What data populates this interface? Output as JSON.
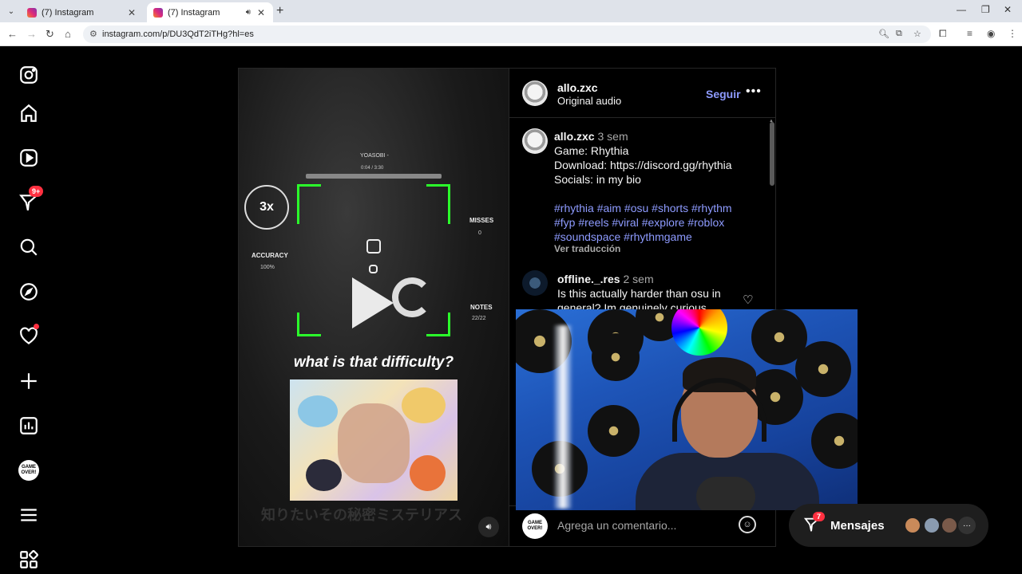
{
  "browser": {
    "tabs": [
      {
        "title": "(7) Instagram",
        "active": false
      },
      {
        "title": "(7) Instagram",
        "active": true
      }
    ],
    "url": "instagram.com/p/DU3QdT2iTHg?hl=es"
  },
  "sidebar": {
    "notifications_badge": "9+",
    "profile_text": "GAME OVER!"
  },
  "video": {
    "song": "YOASOBI -",
    "time": "0:04 / 3:30",
    "combo": "3x",
    "accuracy_label": "ACCURACY",
    "accuracy_value": "100%",
    "misses_label": "MISSES",
    "misses_value": "0",
    "notes_label": "NOTES",
    "notes_value": "22/22",
    "caption": "what is that difficulty?",
    "bottom_text": "知りたいその秘密ミステリアス"
  },
  "post_header": {
    "username": "allo.zxc",
    "audio": "Original audio",
    "follow": "Seguir",
    "more": "•••"
  },
  "caption_comment": {
    "username": "allo.zxc",
    "age": "3 sem",
    "line1": "Game: Rhythia",
    "line2": "Download: https://discord.gg/rhythia",
    "line3": "Socials: in my bio",
    "hashtags1": "#rhythia #aim #osu #shorts #rhythm",
    "hashtags2": "#fyp #reels #viral #explore #roblox",
    "hashtags3": "#soundspace #rhythmgame",
    "translate": "Ver traducción"
  },
  "comment2": {
    "username": "offline._.res",
    "age": "2 sem",
    "line1": "Is this actually harder than osu in",
    "line2": "general? Im genuinely curious"
  },
  "add_comment": {
    "placeholder": "Agrega un comentario...",
    "avatar_text": "GAME OVER!"
  },
  "messages": {
    "label": "Mensajes",
    "badge": "7",
    "more": "···"
  },
  "colors": {
    "accent": "#8e9bff",
    "badge": "#ff3040",
    "bracket": "#2bff2b"
  }
}
